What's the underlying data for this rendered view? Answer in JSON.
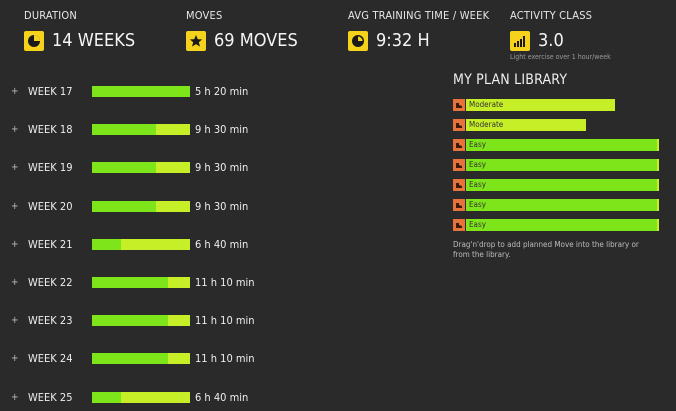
{
  "header": {
    "duration": {
      "label": "DURATION",
      "value": "14 WEEKS",
      "icon": "pie-chart-icon"
    },
    "moves": {
      "label": "MOVES",
      "value": "69 MOVES",
      "icon": "star-icon"
    },
    "avg": {
      "label": "AVG TRAINING TIME / WEEK",
      "value": "9:32 H",
      "icon": "clock-icon"
    },
    "activity": {
      "label": "ACTIVITY CLASS",
      "value": "3.0",
      "note": "Light exercise over 1 hour/week",
      "icon": "signal-bars-icon"
    }
  },
  "weeks": [
    {
      "label": "WEEK 17",
      "time": "5 h 20 min",
      "green_fraction": 1.0
    },
    {
      "label": "WEEK 18",
      "time": "9 h 30 min",
      "green_fraction": 0.65
    },
    {
      "label": "WEEK 19",
      "time": "9 h 30 min",
      "green_fraction": 0.65
    },
    {
      "label": "WEEK 20",
      "time": "9 h 30 min",
      "green_fraction": 0.65
    },
    {
      "label": "WEEK 21",
      "time": "6 h 40 min",
      "green_fraction": 0.3
    },
    {
      "label": "WEEK 22",
      "time": "11 h 10 min",
      "green_fraction": 0.78
    },
    {
      "label": "WEEK 23",
      "time": "11 h 10 min",
      "green_fraction": 0.78
    },
    {
      "label": "WEEK 24",
      "time": "11 h 10 min",
      "green_fraction": 0.78
    },
    {
      "label": "WEEK 25",
      "time": "6 h 40 min",
      "green_fraction": 0.3
    }
  ],
  "library": {
    "title": "MY PLAN LIBRARY",
    "items": [
      {
        "label": "Moderate",
        "kind": "moderate",
        "length_fraction": 0.77
      },
      {
        "label": "Moderate",
        "kind": "moderate",
        "length_fraction": 0.62
      },
      {
        "label": "Easy",
        "kind": "easy",
        "length_fraction": 1.0
      },
      {
        "label": "Easy",
        "kind": "easy",
        "length_fraction": 1.0
      },
      {
        "label": "Easy",
        "kind": "easy",
        "length_fraction": 1.0
      },
      {
        "label": "Easy",
        "kind": "easy",
        "length_fraction": 1.0
      },
      {
        "label": "Easy",
        "kind": "easy",
        "length_fraction": 1.0
      }
    ],
    "help": "Drag'n'drop to add planned Move into the library or from the library."
  },
  "colors": {
    "accent_yellow": "#f5d21b",
    "bar_green": "#7ee51a",
    "bar_lime": "#c6ef28",
    "tag_orange": "#e8733a",
    "background": "#2a2a2a"
  }
}
